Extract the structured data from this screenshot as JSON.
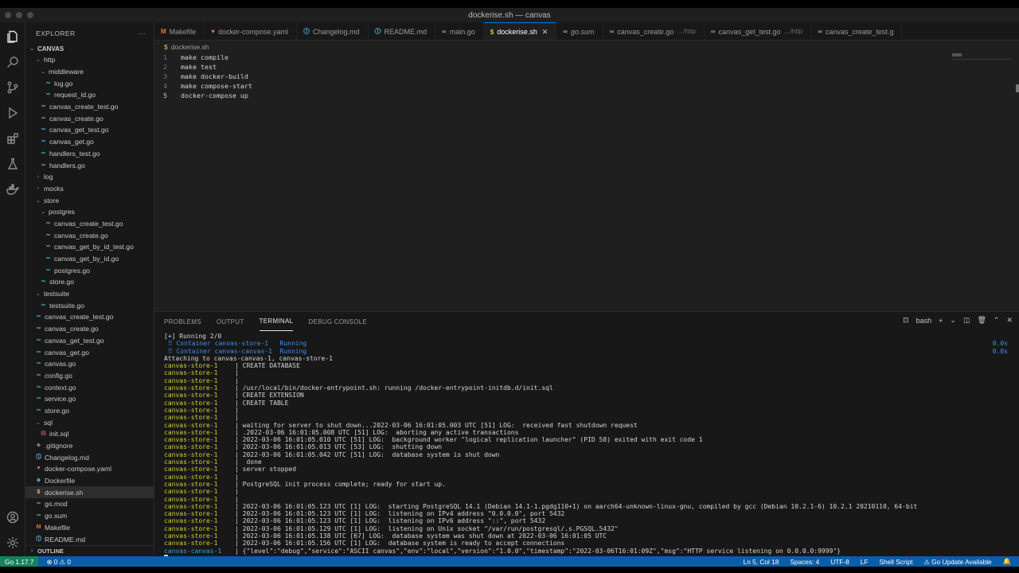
{
  "window": {
    "title": "dockerise.sh — canvas"
  },
  "explorer": {
    "header": "EXPLORER",
    "more": "···",
    "root": "CANVAS",
    "outline": "OUTLINE",
    "items": [
      {
        "label": "http",
        "type": "folder",
        "indent": 1,
        "open": true
      },
      {
        "label": "middleware",
        "type": "folder",
        "indent": 2,
        "open": true
      },
      {
        "label": "log.go",
        "type": "go",
        "indent": 3
      },
      {
        "label": "request_id.go",
        "type": "go",
        "indent": 3
      },
      {
        "label": "canvas_create_test.go",
        "type": "go",
        "indent": 2
      },
      {
        "label": "canvas_create.go",
        "type": "go",
        "indent": 2
      },
      {
        "label": "canvas_get_test.go",
        "type": "go",
        "indent": 2
      },
      {
        "label": "canvas_get.go",
        "type": "go",
        "indent": 2
      },
      {
        "label": "handlers_test.go",
        "type": "go",
        "indent": 2
      },
      {
        "label": "handlers.go",
        "type": "go",
        "indent": 2
      },
      {
        "label": "log",
        "type": "folder",
        "indent": 1,
        "open": false
      },
      {
        "label": "mocks",
        "type": "folder",
        "indent": 1,
        "open": false
      },
      {
        "label": "store",
        "type": "folder",
        "indent": 1,
        "open": true
      },
      {
        "label": "postgres",
        "type": "folder",
        "indent": 2,
        "open": true
      },
      {
        "label": "canvas_create_test.go",
        "type": "go",
        "indent": 3
      },
      {
        "label": "canvas_create.go",
        "type": "go",
        "indent": 3
      },
      {
        "label": "canvas_get_by_id_test.go",
        "type": "go",
        "indent": 3
      },
      {
        "label": "canvas_get_by_id.go",
        "type": "go",
        "indent": 3
      },
      {
        "label": "postgres.go",
        "type": "go",
        "indent": 3
      },
      {
        "label": "store.go",
        "type": "go",
        "indent": 2
      },
      {
        "label": "testsuite",
        "type": "folder",
        "indent": 1,
        "open": true
      },
      {
        "label": "testsuite.go",
        "type": "go",
        "indent": 2
      },
      {
        "label": "canvas_create_test.go",
        "type": "go",
        "indent": 1
      },
      {
        "label": "canvas_create.go",
        "type": "go",
        "indent": 1
      },
      {
        "label": "canvas_get_test.go",
        "type": "go",
        "indent": 1
      },
      {
        "label": "canvas_get.go",
        "type": "go",
        "indent": 1
      },
      {
        "label": "canvas.go",
        "type": "go",
        "indent": 1
      },
      {
        "label": "config.go",
        "type": "go",
        "indent": 1
      },
      {
        "label": "context.go",
        "type": "go",
        "indent": 1
      },
      {
        "label": "service.go",
        "type": "go",
        "indent": 1
      },
      {
        "label": "store.go",
        "type": "go",
        "indent": 1
      },
      {
        "label": "sql",
        "type": "folder",
        "indent": 1,
        "open": true
      },
      {
        "label": "init.sql",
        "type": "sql",
        "indent": 2
      },
      {
        "label": ".gitignore",
        "type": "git",
        "indent": 1
      },
      {
        "label": "Changelog.md",
        "type": "md",
        "indent": 1
      },
      {
        "label": "docker-compose.yaml",
        "type": "yaml",
        "indent": 1
      },
      {
        "label": "Dockerfile",
        "type": "docker",
        "indent": 1
      },
      {
        "label": "dockerise.sh",
        "type": "sh",
        "indent": 1,
        "selected": true
      },
      {
        "label": "go.mod",
        "type": "sum",
        "indent": 1
      },
      {
        "label": "go.sum",
        "type": "sum",
        "indent": 1
      },
      {
        "label": "Makefile",
        "type": "mk",
        "indent": 1
      },
      {
        "label": "README.md",
        "type": "md",
        "indent": 1
      }
    ]
  },
  "tabs": [
    {
      "label": "Makefile",
      "type": "mk"
    },
    {
      "label": "docker-compose.yaml",
      "type": "yaml"
    },
    {
      "label": "Changelog.md",
      "type": "md"
    },
    {
      "label": "README.md",
      "type": "md"
    },
    {
      "label": "main.go",
      "type": "go"
    },
    {
      "label": "dockerise.sh",
      "type": "sh",
      "active": true,
      "close": "✕"
    },
    {
      "label": "go.sum",
      "type": "sum",
      "italic": true
    },
    {
      "label": "canvas_create.go",
      "type": "go",
      "desc": "…/http"
    },
    {
      "label": "canvas_get_test.go",
      "type": "go",
      "desc": "…/http"
    },
    {
      "label": "canvas_create_test.g",
      "type": "go"
    }
  ],
  "editor": {
    "breadcrumb": "dockerise.sh",
    "lines": [
      {
        "n": "1",
        "code": "make compile"
      },
      {
        "n": "2",
        "code": "make test"
      },
      {
        "n": "3",
        "code": "make docker-build"
      },
      {
        "n": "4",
        "code": "make compose-start"
      },
      {
        "n": "5",
        "code": "docker-compose up",
        "current": true
      }
    ]
  },
  "panel": {
    "tabs": [
      "PROBLEMS",
      "OUTPUT",
      "TERMINAL",
      "DEBUG CONSOLE"
    ],
    "active_tab": "TERMINAL",
    "shell": "bash",
    "terminal": [
      {
        "kind": "plain",
        "text": "[+] Running 2/0"
      },
      {
        "kind": "run",
        "text": " ⠿ Container canvas-store-1   Running",
        "time": "0.0s"
      },
      {
        "kind": "run",
        "text": " ⠿ Container canvas-canvas-1  Running",
        "time": "0.0s"
      },
      {
        "kind": "plain",
        "text": "Attaching to canvas-canvas-1, canvas-store-1"
      },
      {
        "kind": "store",
        "svc": "canvas-store-1",
        "text": "| CREATE DATABASE"
      },
      {
        "kind": "store",
        "svc": "canvas-store-1",
        "text": "|"
      },
      {
        "kind": "store",
        "svc": "canvas-store-1",
        "text": "|"
      },
      {
        "kind": "store",
        "svc": "canvas-store-1",
        "text": "| /usr/local/bin/docker-entrypoint.sh: running /docker-entrypoint-initdb.d/init.sql"
      },
      {
        "kind": "store",
        "svc": "canvas-store-1",
        "text": "| CREATE EXTENSION"
      },
      {
        "kind": "store",
        "svc": "canvas-store-1",
        "text": "| CREATE TABLE"
      },
      {
        "kind": "store",
        "svc": "canvas-store-1",
        "text": "|"
      },
      {
        "kind": "store",
        "svc": "canvas-store-1",
        "text": "|"
      },
      {
        "kind": "store",
        "svc": "canvas-store-1",
        "text": "| waiting for server to shut down...2022-03-06 16:01:05.003 UTC [51] LOG:  received fast shutdown request"
      },
      {
        "kind": "store",
        "svc": "canvas-store-1",
        "text": "| .2022-03-06 16:01:05.008 UTC [51] LOG:  aborting any active transactions"
      },
      {
        "kind": "store",
        "svc": "canvas-store-1",
        "text": "| 2022-03-06 16:01:05.010 UTC [51] LOG:  background worker \"logical replication launcher\" (PID 58) exited with exit code 1"
      },
      {
        "kind": "store",
        "svc": "canvas-store-1",
        "text": "| 2022-03-06 16:01:05.013 UTC [53] LOG:  shutting down"
      },
      {
        "kind": "store",
        "svc": "canvas-store-1",
        "text": "| 2022-03-06 16:01:05.042 UTC [51] LOG:  database system is shut down"
      },
      {
        "kind": "store",
        "svc": "canvas-store-1",
        "text": "|  done"
      },
      {
        "kind": "store",
        "svc": "canvas-store-1",
        "text": "| server stopped"
      },
      {
        "kind": "store",
        "svc": "canvas-store-1",
        "text": "|"
      },
      {
        "kind": "store",
        "svc": "canvas-store-1",
        "text": "| PostgreSQL init process complete; ready for start up."
      },
      {
        "kind": "store",
        "svc": "canvas-store-1",
        "text": "|"
      },
      {
        "kind": "store",
        "svc": "canvas-store-1",
        "text": "|"
      },
      {
        "kind": "store",
        "svc": "canvas-store-1",
        "text": "| 2022-03-06 16:01:05.123 UTC [1] LOG:  starting PostgreSQL 14.1 (Debian 14.1-1.pgdg110+1) on aarch64-unknown-linux-gnu, compiled by gcc (Debian 10.2.1-6) 10.2.1 20210110, 64-bit"
      },
      {
        "kind": "store",
        "svc": "canvas-store-1",
        "text": "| 2022-03-06 16:01:05.123 UTC [1] LOG:  listening on IPv4 address \"0.0.0.0\", port 5432"
      },
      {
        "kind": "store",
        "svc": "canvas-store-1",
        "text": "| 2022-03-06 16:01:05.123 UTC [1] LOG:  listening on IPv6 address \"::\", port 5432"
      },
      {
        "kind": "store",
        "svc": "canvas-store-1",
        "text": "| 2022-03-06 16:01:05.129 UTC [1] LOG:  listening on Unix socket \"/var/run/postgresql/.s.PGSQL.5432\""
      },
      {
        "kind": "store",
        "svc": "canvas-store-1",
        "text": "| 2022-03-06 16:01:05.138 UTC [67] LOG:  database system was shut down at 2022-03-06 16:01:05 UTC"
      },
      {
        "kind": "store",
        "svc": "canvas-store-1",
        "text": "| 2022-03-06 16:01:05.156 UTC [1] LOG:  database system is ready to accept connections"
      },
      {
        "kind": "canvas",
        "svc": "canvas-canvas-1",
        "text": "| {\"level\":\"debug\",\"service\":\"ASCII canvas\",\"env\":\"local\",\"version\":\"1.0.0\",\"timestamp\":\"2022-03-06T16:01:09Z\",\"msg\":\"HTTP service listening on 0.0.0.0:9999\"}"
      }
    ]
  },
  "status": {
    "go_version": "Go 1.17.7",
    "problems": "⊗ 0 ⚠ 0",
    "position": "Ln 5, Col 18",
    "spaces": "Spaces: 4",
    "encoding": "UTF-8",
    "eol": "LF",
    "language": "Shell Script",
    "update": "Go Update Available"
  },
  "colors": {
    "statusbar": "#0a5ea8",
    "accent": "#0078d4",
    "service_store": "#cfcc36",
    "service_canvas": "#3aa0d8"
  }
}
